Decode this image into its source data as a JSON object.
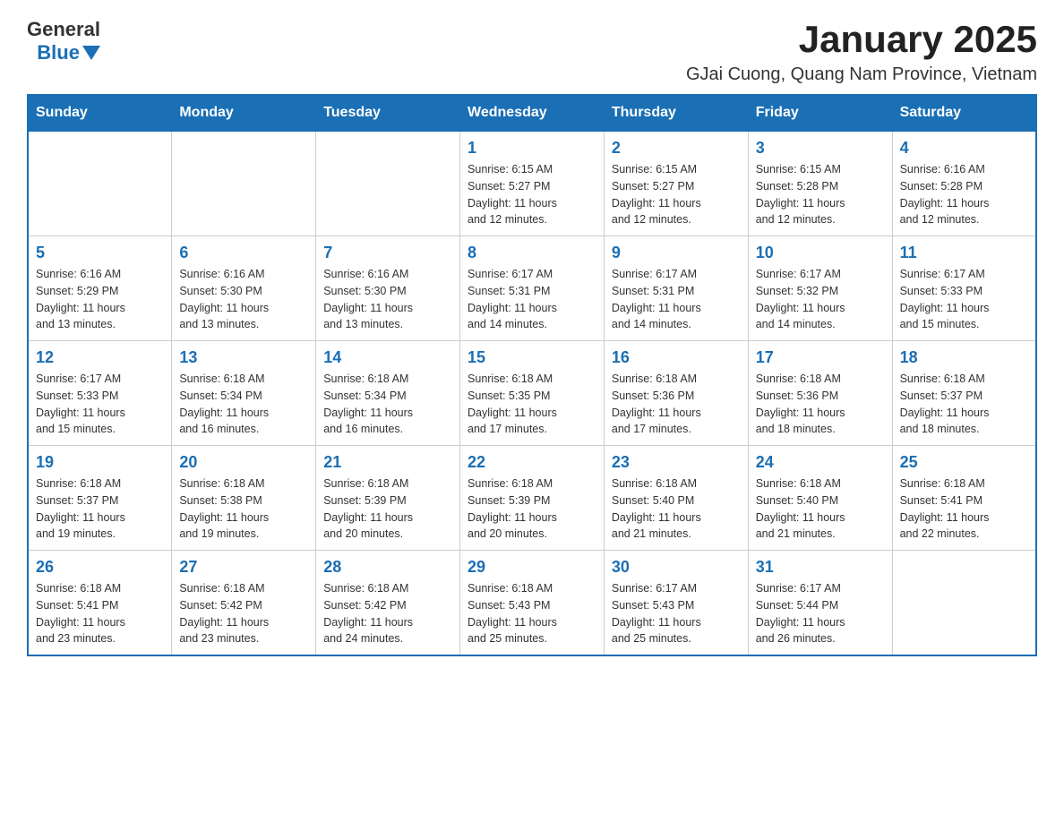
{
  "header": {
    "logo_general": "General",
    "logo_blue": "Blue",
    "title": "January 2025",
    "subtitle": "GJai Cuong, Quang Nam Province, Vietnam"
  },
  "calendar": {
    "days_of_week": [
      "Sunday",
      "Monday",
      "Tuesday",
      "Wednesday",
      "Thursday",
      "Friday",
      "Saturday"
    ],
    "weeks": [
      [
        {
          "day": "",
          "info": ""
        },
        {
          "day": "",
          "info": ""
        },
        {
          "day": "",
          "info": ""
        },
        {
          "day": "1",
          "info": "Sunrise: 6:15 AM\nSunset: 5:27 PM\nDaylight: 11 hours\nand 12 minutes."
        },
        {
          "day": "2",
          "info": "Sunrise: 6:15 AM\nSunset: 5:27 PM\nDaylight: 11 hours\nand 12 minutes."
        },
        {
          "day": "3",
          "info": "Sunrise: 6:15 AM\nSunset: 5:28 PM\nDaylight: 11 hours\nand 12 minutes."
        },
        {
          "day": "4",
          "info": "Sunrise: 6:16 AM\nSunset: 5:28 PM\nDaylight: 11 hours\nand 12 minutes."
        }
      ],
      [
        {
          "day": "5",
          "info": "Sunrise: 6:16 AM\nSunset: 5:29 PM\nDaylight: 11 hours\nand 13 minutes."
        },
        {
          "day": "6",
          "info": "Sunrise: 6:16 AM\nSunset: 5:30 PM\nDaylight: 11 hours\nand 13 minutes."
        },
        {
          "day": "7",
          "info": "Sunrise: 6:16 AM\nSunset: 5:30 PM\nDaylight: 11 hours\nand 13 minutes."
        },
        {
          "day": "8",
          "info": "Sunrise: 6:17 AM\nSunset: 5:31 PM\nDaylight: 11 hours\nand 14 minutes."
        },
        {
          "day": "9",
          "info": "Sunrise: 6:17 AM\nSunset: 5:31 PM\nDaylight: 11 hours\nand 14 minutes."
        },
        {
          "day": "10",
          "info": "Sunrise: 6:17 AM\nSunset: 5:32 PM\nDaylight: 11 hours\nand 14 minutes."
        },
        {
          "day": "11",
          "info": "Sunrise: 6:17 AM\nSunset: 5:33 PM\nDaylight: 11 hours\nand 15 minutes."
        }
      ],
      [
        {
          "day": "12",
          "info": "Sunrise: 6:17 AM\nSunset: 5:33 PM\nDaylight: 11 hours\nand 15 minutes."
        },
        {
          "day": "13",
          "info": "Sunrise: 6:18 AM\nSunset: 5:34 PM\nDaylight: 11 hours\nand 16 minutes."
        },
        {
          "day": "14",
          "info": "Sunrise: 6:18 AM\nSunset: 5:34 PM\nDaylight: 11 hours\nand 16 minutes."
        },
        {
          "day": "15",
          "info": "Sunrise: 6:18 AM\nSunset: 5:35 PM\nDaylight: 11 hours\nand 17 minutes."
        },
        {
          "day": "16",
          "info": "Sunrise: 6:18 AM\nSunset: 5:36 PM\nDaylight: 11 hours\nand 17 minutes."
        },
        {
          "day": "17",
          "info": "Sunrise: 6:18 AM\nSunset: 5:36 PM\nDaylight: 11 hours\nand 18 minutes."
        },
        {
          "day": "18",
          "info": "Sunrise: 6:18 AM\nSunset: 5:37 PM\nDaylight: 11 hours\nand 18 minutes."
        }
      ],
      [
        {
          "day": "19",
          "info": "Sunrise: 6:18 AM\nSunset: 5:37 PM\nDaylight: 11 hours\nand 19 minutes."
        },
        {
          "day": "20",
          "info": "Sunrise: 6:18 AM\nSunset: 5:38 PM\nDaylight: 11 hours\nand 19 minutes."
        },
        {
          "day": "21",
          "info": "Sunrise: 6:18 AM\nSunset: 5:39 PM\nDaylight: 11 hours\nand 20 minutes."
        },
        {
          "day": "22",
          "info": "Sunrise: 6:18 AM\nSunset: 5:39 PM\nDaylight: 11 hours\nand 20 minutes."
        },
        {
          "day": "23",
          "info": "Sunrise: 6:18 AM\nSunset: 5:40 PM\nDaylight: 11 hours\nand 21 minutes."
        },
        {
          "day": "24",
          "info": "Sunrise: 6:18 AM\nSunset: 5:40 PM\nDaylight: 11 hours\nand 21 minutes."
        },
        {
          "day": "25",
          "info": "Sunrise: 6:18 AM\nSunset: 5:41 PM\nDaylight: 11 hours\nand 22 minutes."
        }
      ],
      [
        {
          "day": "26",
          "info": "Sunrise: 6:18 AM\nSunset: 5:41 PM\nDaylight: 11 hours\nand 23 minutes."
        },
        {
          "day": "27",
          "info": "Sunrise: 6:18 AM\nSunset: 5:42 PM\nDaylight: 11 hours\nand 23 minutes."
        },
        {
          "day": "28",
          "info": "Sunrise: 6:18 AM\nSunset: 5:42 PM\nDaylight: 11 hours\nand 24 minutes."
        },
        {
          "day": "29",
          "info": "Sunrise: 6:18 AM\nSunset: 5:43 PM\nDaylight: 11 hours\nand 25 minutes."
        },
        {
          "day": "30",
          "info": "Sunrise: 6:17 AM\nSunset: 5:43 PM\nDaylight: 11 hours\nand 25 minutes."
        },
        {
          "day": "31",
          "info": "Sunrise: 6:17 AM\nSunset: 5:44 PM\nDaylight: 11 hours\nand 26 minutes."
        },
        {
          "day": "",
          "info": ""
        }
      ]
    ]
  }
}
